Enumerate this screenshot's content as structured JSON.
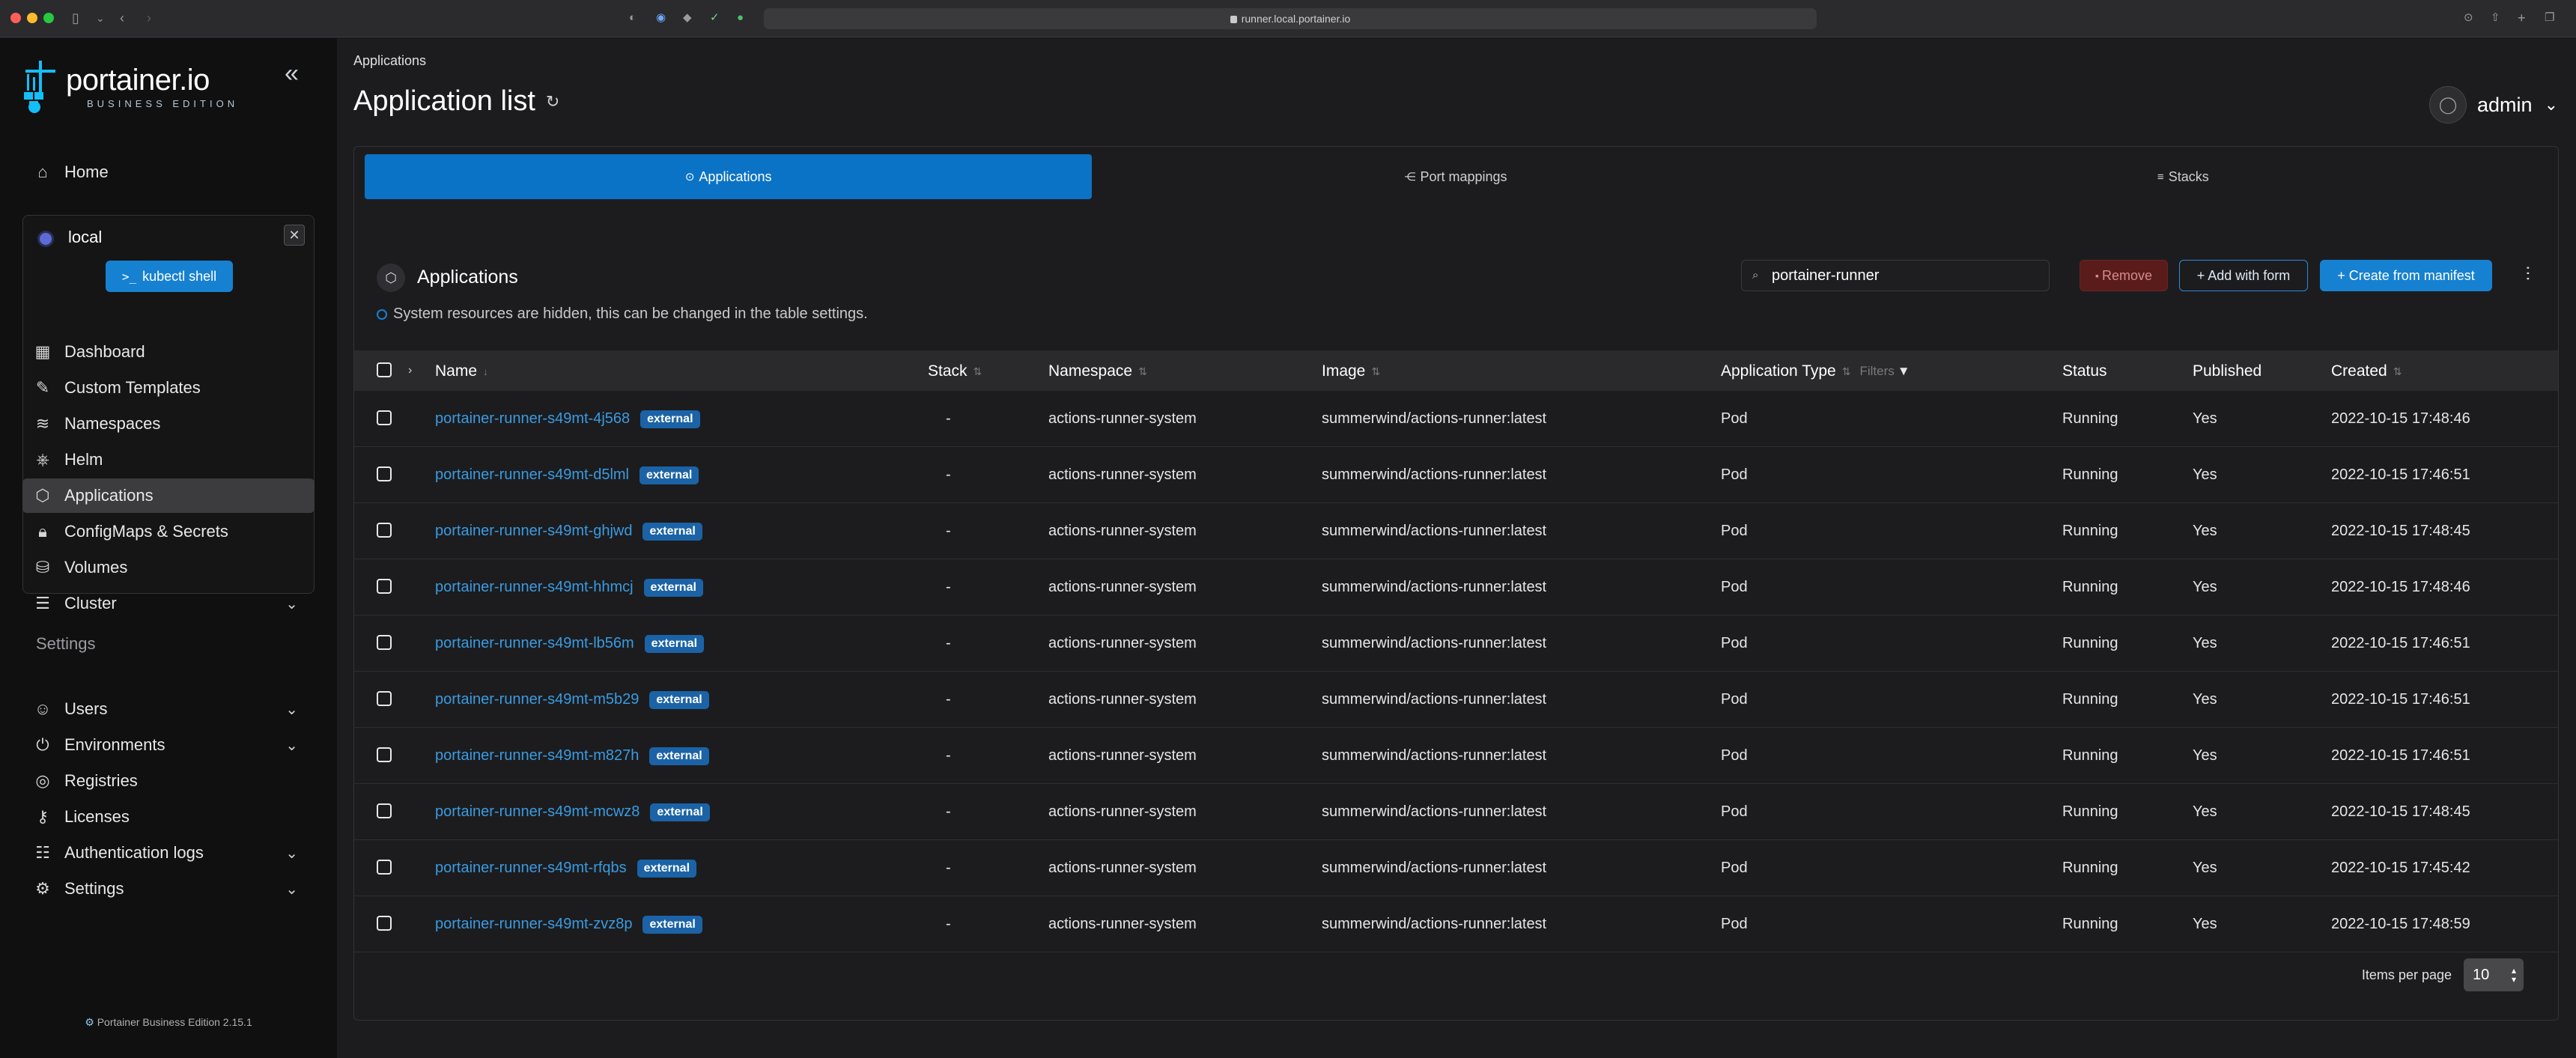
{
  "browser": {
    "url": "runner.local.portainer.io"
  },
  "sidebar": {
    "logo_text": "portainer.io",
    "logo_sub": "BUSINESS EDITION",
    "home": "Home",
    "environment": {
      "name": "local",
      "kubectl_label": "kubectl shell"
    },
    "env_items": [
      {
        "label": "Dashboard",
        "icon": "dashboard-icon"
      },
      {
        "label": "Custom Templates",
        "icon": "edit-icon"
      },
      {
        "label": "Namespaces",
        "icon": "layers-icon"
      },
      {
        "label": "Helm",
        "icon": "helm-icon"
      },
      {
        "label": "Applications",
        "icon": "box-icon",
        "active": true
      },
      {
        "label": "ConfigMaps & Secrets",
        "icon": "lock-icon"
      },
      {
        "label": "Volumes",
        "icon": "database-icon"
      },
      {
        "label": "Cluster",
        "icon": "server-icon",
        "chevron": true
      }
    ],
    "settings_title": "Settings",
    "settings_items": [
      {
        "label": "Users",
        "icon": "users-icon",
        "chevron": true
      },
      {
        "label": "Environments",
        "icon": "plug-icon",
        "chevron": true
      },
      {
        "label": "Registries",
        "icon": "radio-icon"
      },
      {
        "label": "Licenses",
        "icon": "key-icon"
      },
      {
        "label": "Authentication logs",
        "icon": "user-log-icon",
        "chevron": true
      },
      {
        "label": "Settings",
        "icon": "gear-icon",
        "chevron": true
      }
    ],
    "footer": "Portainer Business Edition  2.15.1"
  },
  "header": {
    "breadcrumb": "Applications",
    "title": "Application list",
    "user": "admin"
  },
  "tabs": [
    {
      "label": "Applications",
      "active": true
    },
    {
      "label": "Port mappings"
    },
    {
      "label": "Stacks"
    }
  ],
  "section": {
    "title": "Applications",
    "info": "System resources are hidden, this can be changed in the table settings.",
    "search_value": "portainer-runner",
    "remove_label": "Remove",
    "add_form_label": "+ Add with form",
    "create_manifest_label": "+ Create from manifest"
  },
  "table": {
    "columns": {
      "name": "Name",
      "stack": "Stack",
      "namespace": "Namespace",
      "image": "Image",
      "app_type": "Application Type",
      "filters": "Filters",
      "status": "Status",
      "published": "Published",
      "created": "Created"
    },
    "rows": [
      {
        "name": "portainer-runner-s49mt-4j568",
        "badge": "external",
        "stack": "-",
        "namespace": "actions-runner-system",
        "image": "summerwind/actions-runner:latest",
        "type": "Pod",
        "status": "Running",
        "published": "Yes",
        "created": "2022-10-15 17:48:46"
      },
      {
        "name": "portainer-runner-s49mt-d5lml",
        "badge": "external",
        "stack": "-",
        "namespace": "actions-runner-system",
        "image": "summerwind/actions-runner:latest",
        "type": "Pod",
        "status": "Running",
        "published": "Yes",
        "created": "2022-10-15 17:46:51"
      },
      {
        "name": "portainer-runner-s49mt-ghjwd",
        "badge": "external",
        "stack": "-",
        "namespace": "actions-runner-system",
        "image": "summerwind/actions-runner:latest",
        "type": "Pod",
        "status": "Running",
        "published": "Yes",
        "created": "2022-10-15 17:48:45"
      },
      {
        "name": "portainer-runner-s49mt-hhmcj",
        "badge": "external",
        "stack": "-",
        "namespace": "actions-runner-system",
        "image": "summerwind/actions-runner:latest",
        "type": "Pod",
        "status": "Running",
        "published": "Yes",
        "created": "2022-10-15 17:48:46"
      },
      {
        "name": "portainer-runner-s49mt-lb56m",
        "badge": "external",
        "stack": "-",
        "namespace": "actions-runner-system",
        "image": "summerwind/actions-runner:latest",
        "type": "Pod",
        "status": "Running",
        "published": "Yes",
        "created": "2022-10-15 17:46:51"
      },
      {
        "name": "portainer-runner-s49mt-m5b29",
        "badge": "external",
        "stack": "-",
        "namespace": "actions-runner-system",
        "image": "summerwind/actions-runner:latest",
        "type": "Pod",
        "status": "Running",
        "published": "Yes",
        "created": "2022-10-15 17:46:51"
      },
      {
        "name": "portainer-runner-s49mt-m827h",
        "badge": "external",
        "stack": "-",
        "namespace": "actions-runner-system",
        "image": "summerwind/actions-runner:latest",
        "type": "Pod",
        "status": "Running",
        "published": "Yes",
        "created": "2022-10-15 17:46:51"
      },
      {
        "name": "portainer-runner-s49mt-mcwz8",
        "badge": "external",
        "stack": "-",
        "namespace": "actions-runner-system",
        "image": "summerwind/actions-runner:latest",
        "type": "Pod",
        "status": "Running",
        "published": "Yes",
        "created": "2022-10-15 17:48:45"
      },
      {
        "name": "portainer-runner-s49mt-rfqbs",
        "badge": "external",
        "stack": "-",
        "namespace": "actions-runner-system",
        "image": "summerwind/actions-runner:latest",
        "type": "Pod",
        "status": "Running",
        "published": "Yes",
        "created": "2022-10-15 17:45:42"
      },
      {
        "name": "portainer-runner-s49mt-zvz8p",
        "badge": "external",
        "stack": "-",
        "namespace": "actions-runner-system",
        "image": "summerwind/actions-runner:latest",
        "type": "Pod",
        "status": "Running",
        "published": "Yes",
        "created": "2022-10-15 17:48:59"
      }
    ]
  },
  "pagination": {
    "label": "Items per page",
    "value": "10"
  },
  "colors": {
    "accent": "#1781d1",
    "badge": "#1b63a6",
    "link": "#3a9be2",
    "danger": "#5a1b1b"
  }
}
